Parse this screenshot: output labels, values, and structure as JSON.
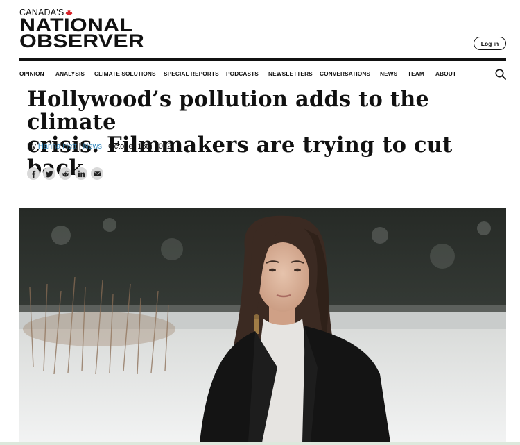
{
  "brand": {
    "line1": "CANADA'S",
    "line2": "NATIONAL",
    "line3": "OBSERVER",
    "leaf_color": "#d8232a"
  },
  "header": {
    "login_label": "Log in"
  },
  "nav": {
    "items": [
      "OPINION",
      "ANALYSIS",
      "CLIMATE SOLUTIONS",
      "SPECIAL REPORTS",
      "PODCASTS",
      "NEWSLETTERS",
      "CONVERSATIONS",
      "NEWS",
      "TEAM",
      "ABOUT"
    ],
    "search_icon": "search-icon"
  },
  "article": {
    "headline_line1": "Hollywood’s pollution adds to the climate",
    "headline_line2": "crisis. Filmmakers are trying to cut back",
    "byline_prefix": "By",
    "author": "Hanna Hett",
    "separator": "|",
    "section": "News",
    "date": "October 13th 2022",
    "link_color": "#3a8dc1"
  },
  "share": {
    "icons": [
      "facebook-icon",
      "twitter-icon",
      "reddit-icon",
      "linkedin-icon",
      "email-icon"
    ]
  },
  "hero": {
    "image": "woman-in-black-blazer-snowy-landscape"
  }
}
